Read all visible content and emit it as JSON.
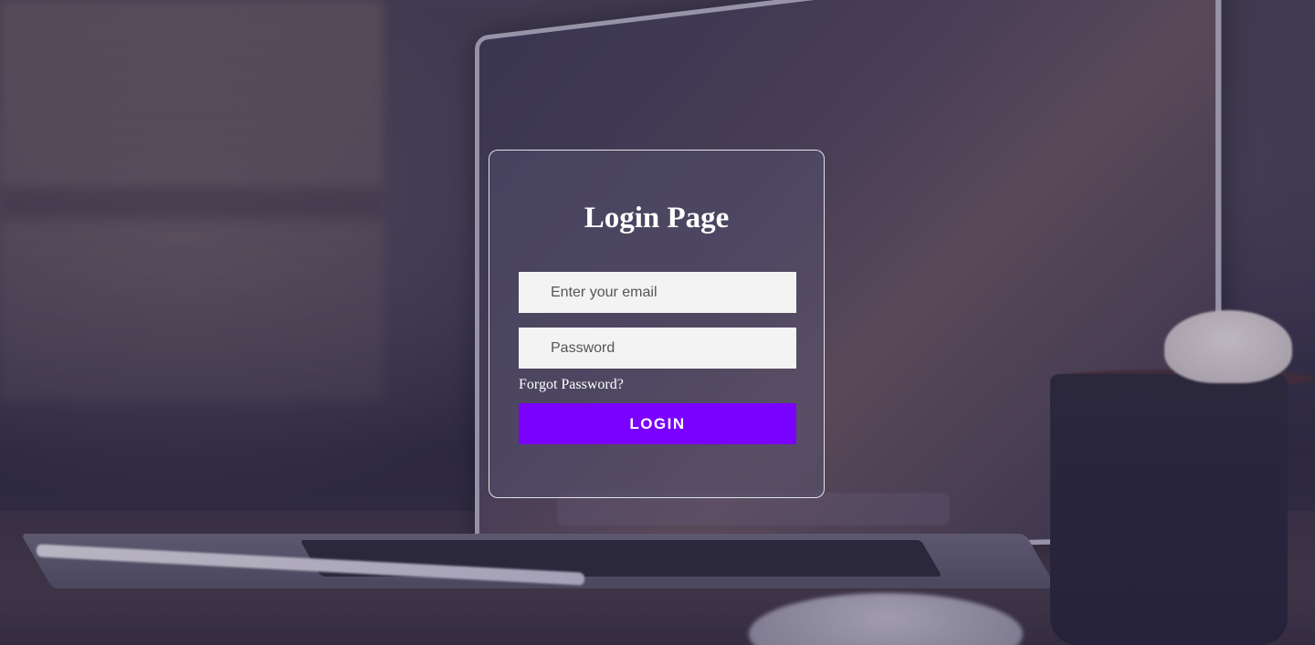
{
  "login": {
    "title": "Login Page",
    "email_placeholder": "Enter your email",
    "password_placeholder": "Password",
    "forgot_password_label": "Forgot Password?",
    "login_button_label": "LOGIN"
  },
  "colors": {
    "accent": "#7a00ff",
    "field_bg": "#f3f3f3",
    "text": "#ffffff"
  }
}
